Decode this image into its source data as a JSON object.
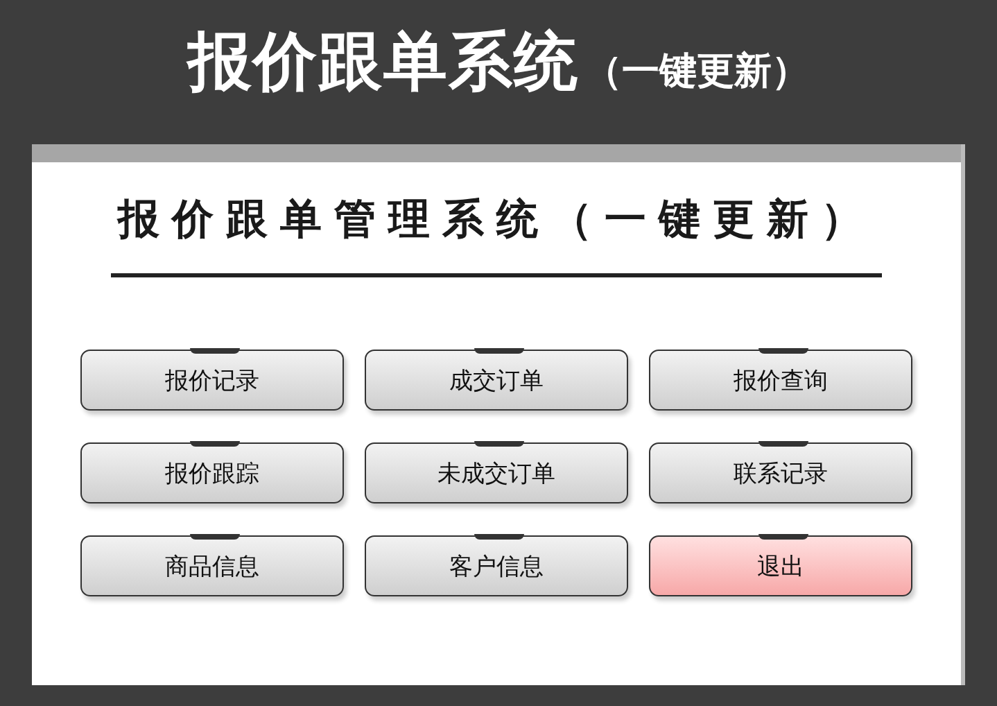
{
  "header": {
    "title": "报价跟单系统",
    "subtitle": "（一键更新）"
  },
  "panel": {
    "title": "报价跟单管理系统（一键更新）",
    "buttons": [
      {
        "label": "报价记录",
        "kind": "normal"
      },
      {
        "label": "成交订单",
        "kind": "normal"
      },
      {
        "label": "报价查询",
        "kind": "normal"
      },
      {
        "label": "报价跟踪",
        "kind": "normal"
      },
      {
        "label": "未成交订单",
        "kind": "normal"
      },
      {
        "label": "联系记录",
        "kind": "normal"
      },
      {
        "label": "商品信息",
        "kind": "normal"
      },
      {
        "label": "客户信息",
        "kind": "normal"
      },
      {
        "label": "退出",
        "kind": "exit"
      }
    ]
  }
}
